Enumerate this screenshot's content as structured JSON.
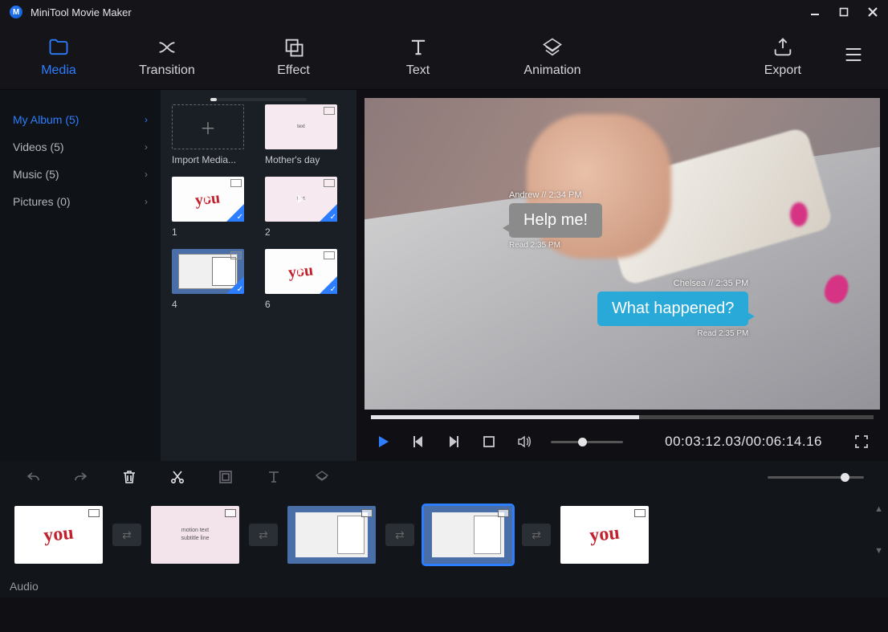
{
  "app": {
    "title": "MiniTool Movie Maker"
  },
  "tabs": {
    "media": "Media",
    "transition": "Transition",
    "effect": "Effect",
    "text": "Text",
    "animation": "Animation",
    "export": "Export"
  },
  "sidebar": {
    "items": [
      {
        "label": "My Album (5)",
        "active": true
      },
      {
        "label": "Videos (5)",
        "active": false
      },
      {
        "label": "Music (5)",
        "active": false
      },
      {
        "label": "Pictures (0)",
        "active": false
      }
    ]
  },
  "media_grid": {
    "import_label": "Import Media...",
    "items": [
      {
        "label": "Mother's day"
      },
      {
        "label": "1"
      },
      {
        "label": "2"
      },
      {
        "label": "4"
      },
      {
        "label": "6"
      }
    ]
  },
  "preview": {
    "chat1_meta": "Andrew // 2:34 PM",
    "chat1_text": "Help me!",
    "chat1_read": "Read 2:35 PM",
    "chat2_meta": "Chelsea // 2:35 PM",
    "chat2_text": "What happened?",
    "chat2_read": "Read 2:35 PM"
  },
  "playback": {
    "current": "00:03:12.03",
    "sep": "/",
    "total": "00:06:14.16"
  },
  "timeline": {
    "audio_label": "Audio"
  }
}
